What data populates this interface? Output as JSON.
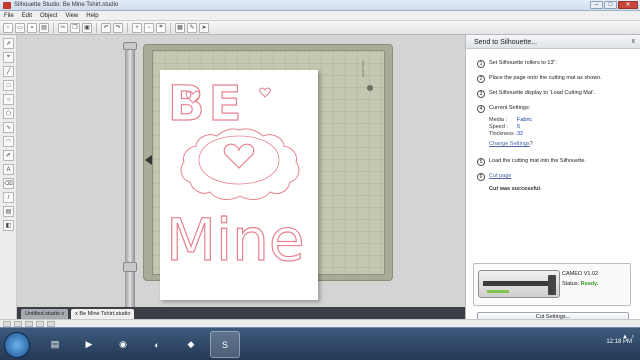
{
  "window": {
    "title": "Silhouette Studio: Be Mine Tshirt.studio",
    "minimize": "–",
    "maximize": "□",
    "close": "✕"
  },
  "menu": [
    "File",
    "Edit",
    "Object",
    "View",
    "Help"
  ],
  "design": {
    "line1": "BE",
    "line2": "Mine",
    "stroke_color": "#e8828f"
  },
  "mat": {
    "brand": "silhouette"
  },
  "panel": {
    "title": "Send to Silhouette...",
    "close": "x",
    "steps": [
      {
        "num": "1",
        "text": "Set Silhouette rollers to 13\"."
      },
      {
        "num": "2",
        "text": "Place the page onto the cutting mat as shown."
      },
      {
        "num": "3",
        "text": "Set Silhouette display to 'Load Cutting Mat'."
      },
      {
        "num": "4",
        "text": "Current Settings:"
      },
      {
        "num": "5",
        "text": "Load the cutting mat into the Silhouette."
      },
      {
        "num": "6",
        "text": "Cut page"
      }
    ],
    "settings": [
      {
        "label": "Media :",
        "value": "Fabric"
      },
      {
        "label": "Speed :",
        "value": "5"
      },
      {
        "label": "Thickness :",
        "value": "32"
      }
    ],
    "change_settings": "Change Settings",
    "change_settings_suffix": "?",
    "result": "Cut was successful.",
    "device_name": "CAMEO V1.02",
    "device_status_label": "Status:",
    "device_status_value": "Ready.",
    "cut_settings_button": "Cut Settings..."
  },
  "tabs": [
    {
      "label": "Untitled.studio",
      "close": "x"
    },
    {
      "label": "Be Mine Tshirt.studio",
      "close": "x"
    }
  ],
  "taskbar": {
    "time": "12:18 PM"
  }
}
